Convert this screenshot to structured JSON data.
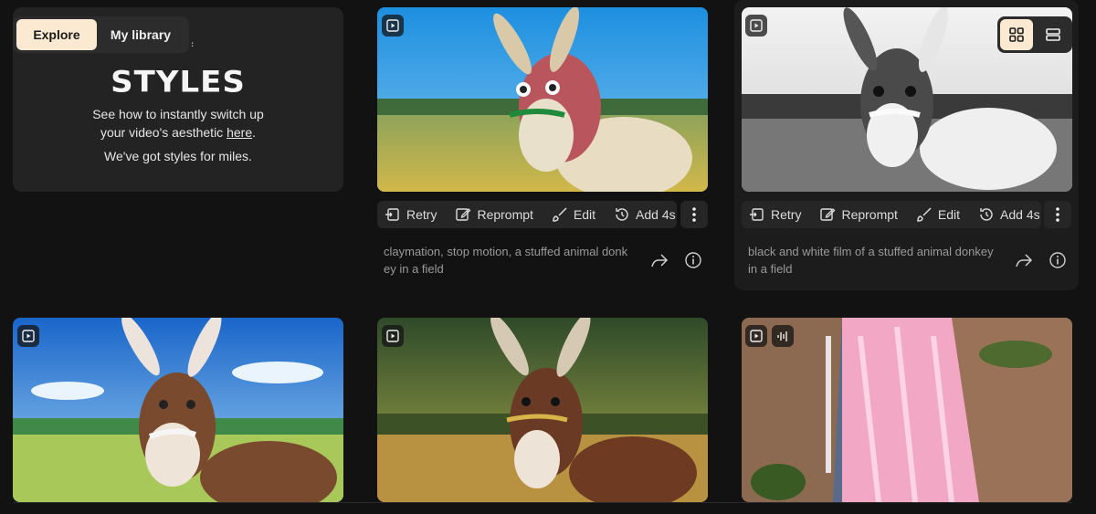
{
  "tabs": [
    {
      "label": "Explore",
      "active": true
    },
    {
      "label": "My library",
      "active": false
    }
  ],
  "feature": {
    "kicker": "ATURE:",
    "title": "STYLES",
    "desc_line1": "See how to instantly switch up",
    "desc_line2_prefix": "your video's aesthetic ",
    "desc_link": "here",
    "desc_line2_suffix": ".",
    "desc_line3": "We've got styles for miles."
  },
  "view_toggle": {
    "grid_icon": "grid-icon",
    "list_icon": "list-icon",
    "active": "grid"
  },
  "actions": {
    "retry": "Retry",
    "reprompt": "Reprompt",
    "edit": "Edit",
    "add": "Add 4s"
  },
  "cards": [
    {
      "prompt": "claymation, stop motion, a stuffed animal donkey in a field",
      "badge_icon": "play-icon"
    },
    {
      "prompt": "black and white film of a stuffed animal donkey in a field",
      "badge_icon": "play-icon"
    }
  ],
  "row2": [
    {
      "badge_icon": "play-icon",
      "scene": "anime donkey on grassy field"
    },
    {
      "badge_icon": "play-icon",
      "scene": "realistic donkey in golden field"
    },
    {
      "badge_icon": "play-icon",
      "extra_icon": "audio-waveform-icon",
      "scene": "pink waterfall over rocks"
    }
  ],
  "colors": {
    "accent": "#fbe9d2",
    "background": "#121212",
    "card": "#232323"
  }
}
